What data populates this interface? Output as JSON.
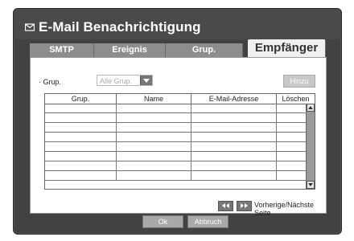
{
  "window": {
    "title": "E-Mail Benachrichtigung",
    "title_icon": "envelope-icon"
  },
  "tabs": [
    {
      "label": "SMTP",
      "active": false
    },
    {
      "label": "Ereignis",
      "active": false
    },
    {
      "label": "Grup.",
      "active": false
    },
    {
      "label": "Empfänger",
      "active": true
    }
  ],
  "filter": {
    "label": "· Grup.",
    "select_value": "Alle Grup.",
    "add_label": "Hinzu"
  },
  "table": {
    "columns": [
      "Grup.",
      "Name",
      "E-Mail-Adresse",
      "Löschen"
    ],
    "rows": [
      [
        "",
        "",
        "",
        ""
      ],
      [
        "",
        "",
        "",
        ""
      ],
      [
        "",
        "",
        "",
        ""
      ],
      [
        "",
        "",
        "",
        ""
      ],
      [
        "",
        "",
        "",
        ""
      ],
      [
        "",
        "",
        "",
        ""
      ],
      [
        "",
        "",
        "",
        ""
      ],
      [
        "",
        "",
        "",
        ""
      ]
    ]
  },
  "pager": {
    "prev_icon": "double-left-arrow-icon",
    "next_icon": "double-right-arrow-icon",
    "label": "Vorherige/Nächste Seite"
  },
  "footer": {
    "ok_label": "Ok",
    "cancel_label": "Abbruch"
  },
  "colors": {
    "dialog_bg": "#424242",
    "tab_bg": "#8d8d8d",
    "active_tab_bg": "#f0f0f0",
    "content_bg": "#ffffff",
    "button_bg": "#a8a8a8"
  }
}
